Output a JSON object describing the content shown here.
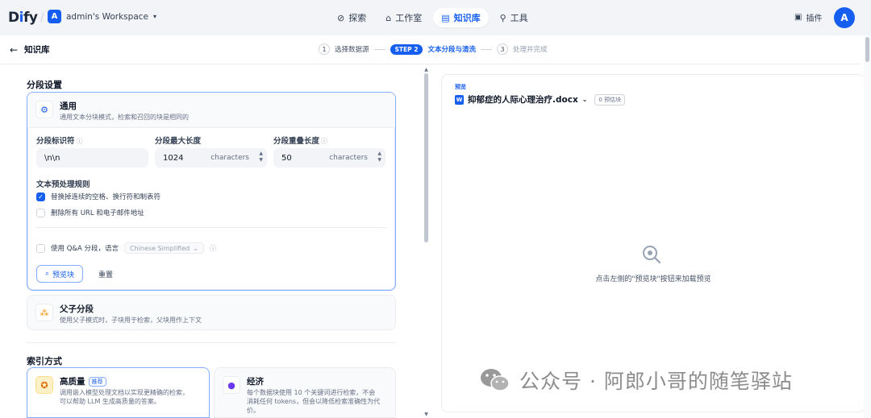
{
  "nav": {
    "logo": "Dify",
    "workspace_initial": "A",
    "workspace_name": "admin's Workspace",
    "items": [
      {
        "label": "探索",
        "icon": "compass-icon"
      },
      {
        "label": "工作室",
        "icon": "robot-icon"
      },
      {
        "label": "知识库",
        "icon": "book-icon",
        "active": true
      },
      {
        "label": "工具",
        "icon": "tools-icon"
      }
    ],
    "plugin_label": "插件",
    "avatar_initial": "A"
  },
  "breadcrumb": "知识库",
  "steps": [
    {
      "num": "1",
      "label": "选择数据源"
    },
    {
      "num": "STEP 2",
      "label": "文本分段与清洗",
      "active": true
    },
    {
      "num": "3",
      "label": "处理并完成"
    }
  ],
  "segment": {
    "title": "分段设置",
    "general": {
      "title": "通用",
      "desc": "通用文本分块模式，检索和召回的块是相同的",
      "delimiter_label": "分段标识符",
      "delimiter_value": "\\n\\n",
      "max_len_label": "分段最大长度",
      "max_len_value": "1024",
      "max_len_unit": "characters",
      "overlap_label": "分段重叠长度",
      "overlap_value": "50",
      "overlap_unit": "characters",
      "rules_title": "文本预处理规则",
      "rule1": "替换掉连续的空格、换行符和制表符",
      "rule1_checked": true,
      "rule2": "删除所有 URL 和电子邮件地址",
      "rule2_checked": false,
      "qa_label": "使用 Q&A 分段，语言",
      "qa_language": "Chinese Simplified",
      "preview_btn": "预览块",
      "reset_btn": "重置"
    },
    "parent": {
      "title": "父子分段",
      "desc": "使用父子模式时，子块用于检索，父块用作上下文"
    }
  },
  "index": {
    "title": "索引方式",
    "high": {
      "title": "高质量",
      "badge": "推荐",
      "desc1": "调用嵌入模型处理文档以实现更精确的检索，",
      "desc2": "可以帮助 LLM 生成高质量的答案。"
    },
    "eco": {
      "title": "经济",
      "desc1": "每个数据块使用 10 个关键词进行检索，不会",
      "desc2": "消耗任何 tokens，但会以降低检索准确性为代",
      "desc3": "价。"
    }
  },
  "preview": {
    "label": "预览",
    "filename": "抑郁症的人际心理治疗.docx",
    "count": "0 预估块",
    "empty": "点击左侧的\"预览块\"按钮来加载预览"
  },
  "watermark": "公众号 · 阿郎小哥的随笔驿站",
  "colors": {
    "accent": "#155eef",
    "border_active": "#84adff",
    "bg": "#f2f4f7"
  }
}
